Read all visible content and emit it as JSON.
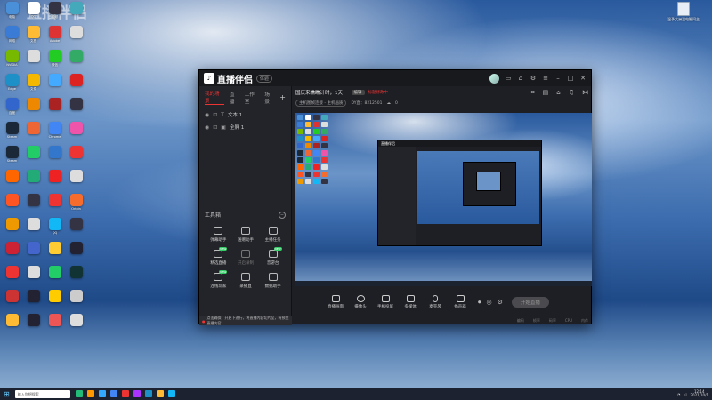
{
  "desktop": {
    "watermark": "直播伴侣",
    "recycle_label": "温予大洲温电脑问主",
    "icons": [
      {
        "label": "电脑",
        "color": "#4a90d9"
      },
      {
        "label": "QQ",
        "color": "#ffffff"
      },
      {
        "label": "视频",
        "color": "#334"
      },
      {
        "label": "",
        "color": "#4ab"
      },
      {
        "label": "网络",
        "color": "#3a7bd5"
      },
      {
        "label": "文档",
        "color": "#fb3"
      },
      {
        "label": "Adobe",
        "color": "#d33"
      },
      {
        "label": "",
        "color": "#ddd"
      },
      {
        "label": "NVIDIA",
        "color": "#76b900"
      },
      {
        "label": "",
        "color": "#ddd"
      },
      {
        "label": "微信",
        "color": "#2c2"
      },
      {
        "label": "",
        "color": "#3a6"
      },
      {
        "label": "Edge",
        "color": "#1e90c8"
      },
      {
        "label": "文件",
        "color": "#f5b800"
      },
      {
        "label": "",
        "color": "#4af"
      },
      {
        "label": "",
        "color": "#d22"
      },
      {
        "label": "百度",
        "color": "#36c"
      },
      {
        "label": "",
        "color": "#e80"
      },
      {
        "label": "",
        "color": "#a22"
      },
      {
        "label": "",
        "color": "#334"
      },
      {
        "label": "Steam",
        "color": "#1b2838"
      },
      {
        "label": "",
        "color": "#e63"
      },
      {
        "label": "Chrome",
        "color": "#4285f4"
      },
      {
        "label": "",
        "color": "#e5a"
      },
      {
        "label": "Steam",
        "color": "#1b2838"
      },
      {
        "label": "",
        "color": "#2c6"
      },
      {
        "label": "",
        "color": "#37c"
      },
      {
        "label": "",
        "color": "#e33"
      },
      {
        "label": "",
        "color": "#f60"
      },
      {
        "label": "",
        "color": "#2a7"
      },
      {
        "label": "",
        "color": "#e22"
      },
      {
        "label": "",
        "color": "#ddd"
      },
      {
        "label": "",
        "color": "#f52"
      },
      {
        "label": "",
        "color": "#334"
      },
      {
        "label": "",
        "color": "#e33"
      },
      {
        "label": "Origin",
        "color": "#f56c2d"
      },
      {
        "label": "",
        "color": "#e90"
      },
      {
        "label": "",
        "color": "#ddd"
      },
      {
        "label": "QQ",
        "color": "#12b7f5"
      },
      {
        "label": "",
        "color": "#334"
      },
      {
        "label": "",
        "color": "#c23"
      },
      {
        "label": "",
        "color": "#46c"
      },
      {
        "label": "",
        "color": "#fc3"
      },
      {
        "label": "",
        "color": "#223"
      },
      {
        "label": "",
        "color": "#e33"
      },
      {
        "label": "",
        "color": "#ddd"
      },
      {
        "label": "",
        "color": "#2c6"
      },
      {
        "label": "",
        "color": "#133"
      },
      {
        "label": "",
        "color": "#c33"
      },
      {
        "label": "",
        "color": "#223"
      },
      {
        "label": "",
        "color": "#fc0"
      },
      {
        "label": "",
        "color": "#ccc"
      },
      {
        "label": "",
        "color": "#fb3"
      },
      {
        "label": "",
        "color": "#223"
      },
      {
        "label": "",
        "color": "#e55"
      },
      {
        "label": "",
        " color": "#fff"
      }
    ]
  },
  "app": {
    "name": "直播伴侣",
    "version_badge": "体验",
    "tabs": [
      "我的场景",
      "直播",
      "工作室",
      "场景"
    ],
    "sources": [
      {
        "label": "文本 1"
      },
      {
        "label": "全屏 1"
      }
    ],
    "tools_header": "工具箱",
    "tools": [
      {
        "label": "弹幕助手",
        "badge": ""
      },
      {
        "label": "送赠助手",
        "badge": ""
      },
      {
        "label": "主播任务",
        "badge": ""
      },
      {
        "label": "精选直播",
        "badge": "NEW"
      },
      {
        "label": "开启录制",
        "badge": ""
      },
      {
        "label": "音游台",
        "badge": "NEW"
      },
      {
        "label": "连线玩家",
        "badge": "NEW"
      },
      {
        "label": "录播直",
        "badge": ""
      },
      {
        "label": "数据助手",
        "badge": ""
      }
    ],
    "live_title": "国庆来瞧瞧计时，1天！",
    "edit_label": "编辑",
    "live_red_text": "标题修改中",
    "sub_pill": "主机图帧连接 - 主机画质",
    "sub_id": "DY直：8212501",
    "sub_count": "0",
    "bottom_tools": [
      "直播画面",
      "摄像头",
      "手机投屏",
      "多媒体",
      "麦克风",
      "扬声器"
    ],
    "start_live": "开始直播",
    "status_items": [
      "编码",
      "帧率",
      "码率",
      "CPU",
      "内存"
    ],
    "notice_text": "点击确保，开启下进行，将直播内容切片至，有预览直播内容"
  },
  "taskbar": {
    "search_placeholder": "输入你想搜索",
    "time": "12:14",
    "date": "2021/10/1",
    "icon_colors": [
      "#2b7",
      "#f90",
      "#3af",
      "#4285f4",
      "#e33",
      "#a3f",
      "#1e90c8",
      "#fb3",
      "#12b7f5"
    ]
  }
}
